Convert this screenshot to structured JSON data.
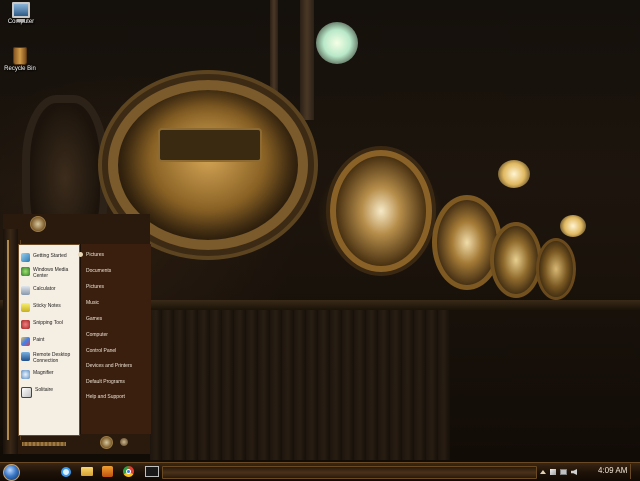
{
  "desktop": {
    "icons": [
      {
        "label": "Computer",
        "icon": "computer-icon"
      },
      {
        "label": "Recycle Bin",
        "icon": "recycle-bin-icon"
      }
    ]
  },
  "start_menu": {
    "left_items": [
      {
        "label": "Getting Started",
        "icon": "getting-started-icon"
      },
      {
        "label": "Windows Media Center",
        "icon": "media-center-icon"
      },
      {
        "label": "Calculator",
        "icon": "calculator-icon"
      },
      {
        "label": "Sticky Notes",
        "icon": "sticky-notes-icon"
      },
      {
        "label": "Snipping Tool",
        "icon": "snipping-tool-icon"
      },
      {
        "label": "Paint",
        "icon": "paint-icon"
      },
      {
        "label": "Remote Desktop Connection",
        "icon": "remote-desktop-icon"
      },
      {
        "label": "Magnifier",
        "icon": "magnifier-icon"
      },
      {
        "label": "Solitaire",
        "icon": "solitaire-icon"
      }
    ],
    "right_items": [
      "Pictures",
      "Documents",
      "Pictures",
      "Music",
      "Games",
      "Computer",
      "Control Panel",
      "Devices and Printers",
      "Default Programs",
      "Help and Support"
    ]
  },
  "taskbar": {
    "pinned": [
      {
        "name": "Internet Explorer",
        "icon": "internet-explorer-icon"
      },
      {
        "name": "Windows Explorer",
        "icon": "folder-icon"
      },
      {
        "name": "Windows Media Player",
        "icon": "media-player-icon"
      },
      {
        "name": "Google Chrome",
        "icon": "chrome-icon"
      },
      {
        "name": "Command Prompt",
        "icon": "command-prompt-icon"
      }
    ],
    "clock": "4:09 AM"
  },
  "colors": {
    "taskbar": "#1e1208",
    "start_menu_left": "#f5eee3",
    "start_menu_right": "#3a1e0e",
    "brass": "#b08a4a"
  }
}
